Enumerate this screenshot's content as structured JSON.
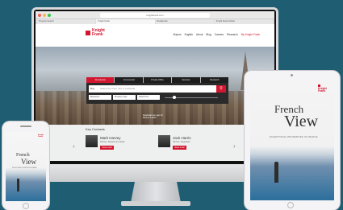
{
  "browser": {
    "address": "knightfrank.com",
    "tabs": [
      "Property Search",
      "Knight Frank",
      "Residential",
      "Knight Frank Global"
    ]
  },
  "site": {
    "logo_line1": "Knight",
    "logo_line2": "Frank",
    "nav": [
      "Buyers",
      "English",
      "About",
      "Blog",
      "Careers",
      "Research",
      "My Knight Frank"
    ],
    "search": {
      "tabs": [
        "Residential",
        "Commercial",
        "Private Office",
        "Services",
        "Research"
      ],
      "label": "Buy",
      "placeholder": "Search by town, city or postcode",
      "filters": [
        "Bedrooms",
        "Property Type",
        "Search Km"
      ]
    },
    "footer_note_1": "Download our app for",
    "footer_note_2": "iPhone & iPad",
    "contacts": {
      "heading": "Key Contacts",
      "people": [
        {
          "name": "Mark Harvey",
          "role": "Partner, Department Head",
          "cta": "Send email"
        },
        {
          "name": "Jack Harris",
          "role": "Partner, Negotiator",
          "cta": "Send email"
        }
      ]
    }
  },
  "magazine": {
    "title_line1": "French",
    "title_line2": "View",
    "subtitle": "EXCEPTIONAL PROPERTIES IN FRANCE"
  },
  "colors": {
    "brand_red": "#d3162f",
    "background": "#1f5d72"
  }
}
